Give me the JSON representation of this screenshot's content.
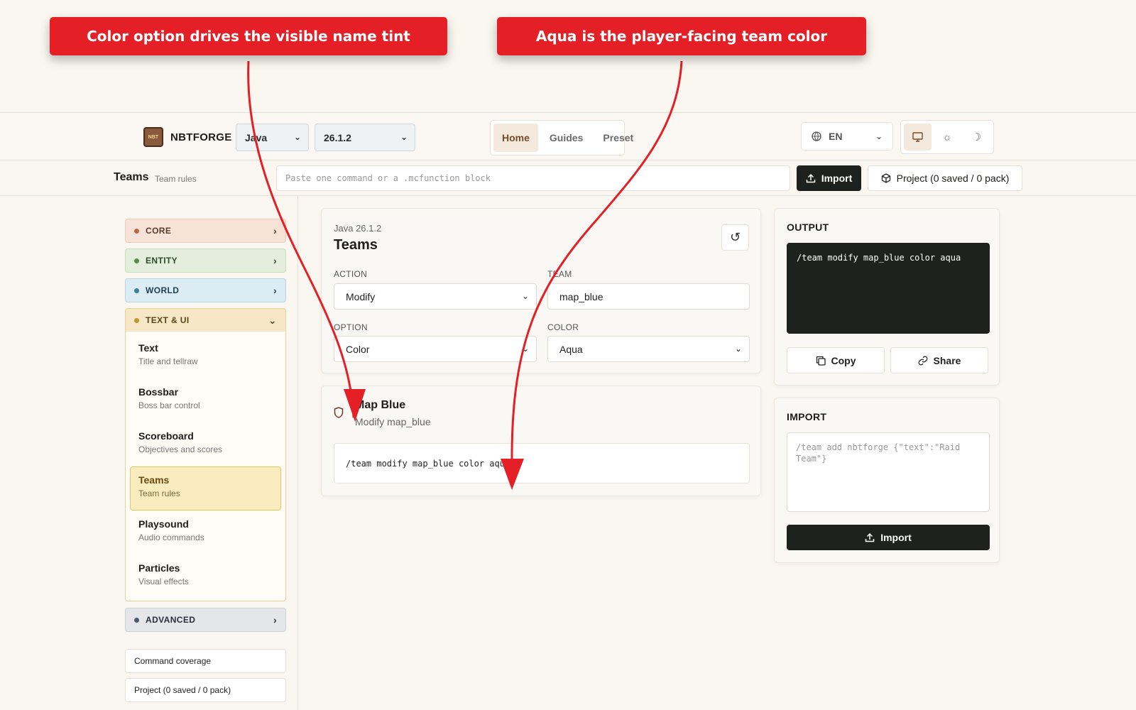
{
  "annotations": {
    "callout_1": "Color option drives the visible name tint",
    "callout_2": "Aqua is the player-facing team color",
    "color": "#e41f26"
  },
  "header": {
    "brand": "NBTFORGE",
    "brand_logo_text": "NBT",
    "edition": "Java",
    "version": "26.1.2",
    "nav": [
      "Home",
      "Guides",
      "Preset"
    ],
    "nav_active": "Home",
    "language": "EN",
    "theme_buttons": [
      "monitor-icon",
      "sun-icon",
      "moon-icon"
    ]
  },
  "toolbar": {
    "page_title": "Teams",
    "page_subtitle": "Team rules",
    "command_placeholder": "Paste one command or a .mcfunction block",
    "import_label": "Import",
    "project_label": "Project (0 saved / 0 pack)"
  },
  "sidebar": {
    "categories": {
      "core": "CORE",
      "entity": "ENTITY",
      "world": "WORLD",
      "text_ui": "TEXT & UI",
      "advanced": "ADVANCED"
    },
    "text_ui_items": [
      {
        "title": "Text",
        "subtitle": "Title and tellraw"
      },
      {
        "title": "Bossbar",
        "subtitle": "Boss bar control"
      },
      {
        "title": "Scoreboard",
        "subtitle": "Objectives and scores"
      },
      {
        "title": "Teams",
        "subtitle": "Team rules"
      },
      {
        "title": "Playsound",
        "subtitle": "Audio commands"
      },
      {
        "title": "Particles",
        "subtitle": "Visual effects"
      }
    ],
    "active_item": "Teams",
    "command_coverage": "Command coverage",
    "project": "Project (0 saved / 0 pack)"
  },
  "form": {
    "version_label": "Java 26.1.2",
    "title": "Teams",
    "action_label": "ACTION",
    "action_value": "Modify",
    "team_label": "TEAM",
    "team_value": "map_blue",
    "option_label": "OPTION",
    "option_value": "Color",
    "color_label": "COLOR",
    "color_value": "Aqua"
  },
  "preview": {
    "title": "Map Blue",
    "subtitle": "Modify map_blue",
    "command": "/team modify map_blue color aqua"
  },
  "output": {
    "heading": "OUTPUT",
    "command": "/team modify map_blue color aqua",
    "copy_label": "Copy",
    "share_label": "Share"
  },
  "import": {
    "heading": "IMPORT",
    "placeholder": "/team add nbtforge {\"text\":\"Raid Team\"}",
    "button_label": "Import"
  }
}
